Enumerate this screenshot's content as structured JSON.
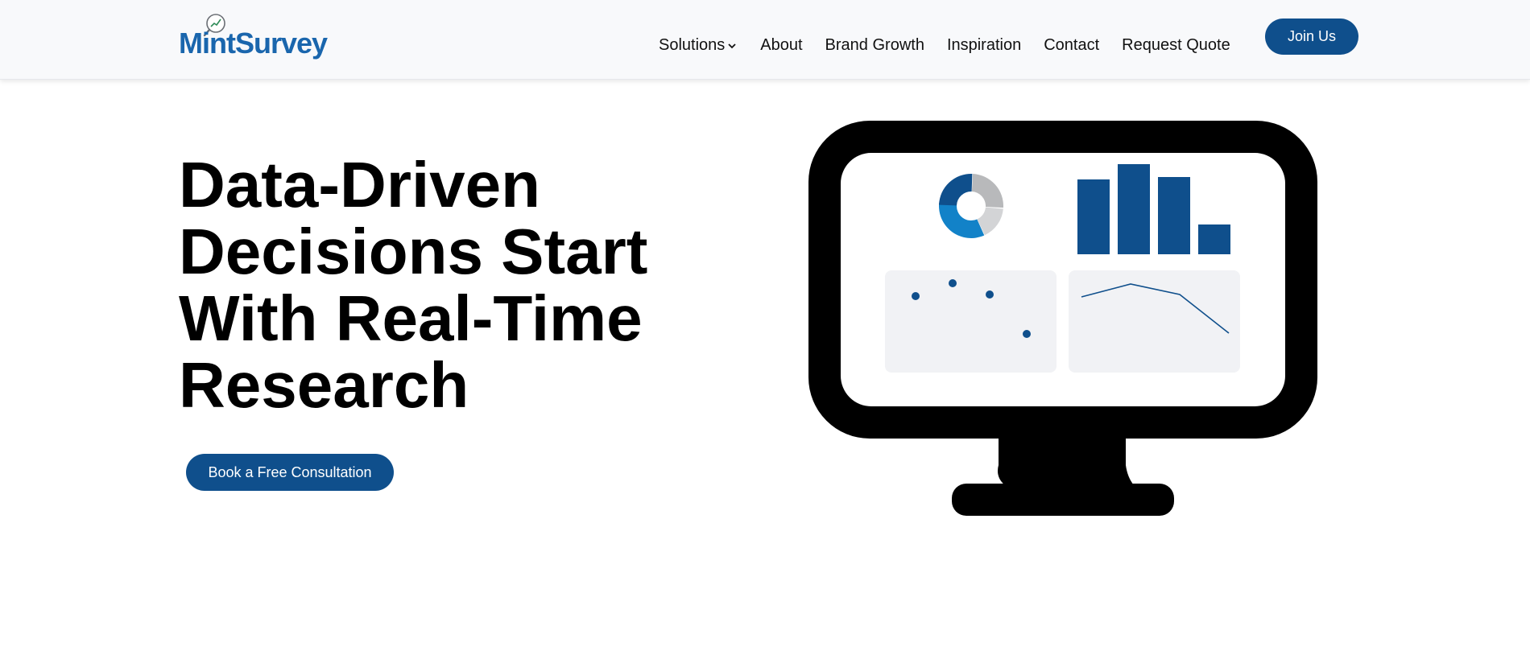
{
  "brand": {
    "name": "MintSurvey",
    "color": "#1a66ad",
    "icon": "magnifier-chart-icon"
  },
  "nav": {
    "items": [
      {
        "label": "Solutions",
        "has_dropdown": true
      },
      {
        "label": "About"
      },
      {
        "label": "Brand Growth"
      },
      {
        "label": "Inspiration"
      },
      {
        "label": "Contact"
      },
      {
        "label": "Request Quote"
      }
    ],
    "join_label": "Join Us"
  },
  "hero": {
    "title_lines": [
      "Data-Driven",
      "Decisions Start",
      "With Real-Time",
      "Research"
    ],
    "cta_label": "Book a Free Consultation"
  },
  "illustration": {
    "icon": "monitor-dashboard-illustration",
    "colors": {
      "primary": "#0f4f8c",
      "accent": "#1282c8",
      "grey": "#b8b9bb",
      "light_grey": "#d3d4d6",
      "panel": "#f1f2f5"
    }
  }
}
